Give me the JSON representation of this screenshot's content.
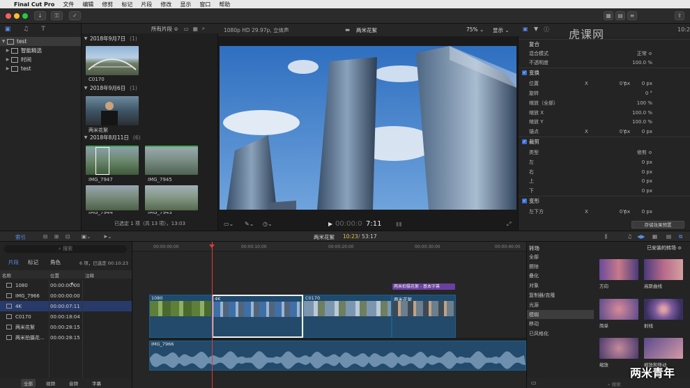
{
  "menubar": {
    "app": "Final Cut Pro",
    "items": [
      "文件",
      "编辑",
      "修剪",
      "标记",
      "片段",
      "修改",
      "显示",
      "窗口",
      "帮助"
    ]
  },
  "sidebar": {
    "items": [
      {
        "label": "test",
        "level": 0
      },
      {
        "label": "智能精选",
        "level": 1
      },
      {
        "label": "时间",
        "level": 1
      },
      {
        "label": "test",
        "level": 1
      }
    ]
  },
  "browser": {
    "filter": "所有片段 ≎",
    "groups": [
      {
        "date": "2018年9月7日",
        "count": "(1)"
      },
      {
        "date": "2018年9月6日",
        "count": "(1)"
      },
      {
        "date": "2018年8月11日",
        "count": "(6)"
      }
    ],
    "clips": [
      "C0170",
      "两米花絮",
      "IMG_7947",
      "IMG_7945",
      "IMG_7944",
      "IMG_7943"
    ],
    "status": "已选定 1 项（共 13 项），13:03"
  },
  "viewer": {
    "format": "1080p HD 29.97p, 立体声",
    "title": "两米花絮",
    "zoom": "75% ⌄",
    "display": "显示 ⌄",
    "timecode_dim": "00:00:0",
    "timecode": "7:11"
  },
  "inspector": {
    "rows": [
      {
        "label": "复合",
        "type": "header"
      },
      {
        "label": "混合模式",
        "v2": "正常 ≎"
      },
      {
        "label": "不透明度",
        "v2": "100.0 %"
      },
      {
        "label": "变换",
        "type": "section"
      },
      {
        "label": "位置",
        "c1": "X",
        "v1": "0 px",
        "c2": "Y",
        "v2": "0 px"
      },
      {
        "label": "旋转",
        "v2": "0 °"
      },
      {
        "label": "缩放（全部）",
        "v2": "100 %"
      },
      {
        "label": "缩放 X",
        "v2": "100.0 %"
      },
      {
        "label": "缩放 Y",
        "v2": "100.0 %"
      },
      {
        "label": "锚点",
        "c1": "X",
        "v1": "0 px",
        "c2": "Y",
        "v2": "0 px"
      },
      {
        "label": "裁剪",
        "type": "section"
      },
      {
        "label": "类型",
        "v2": "修剪 ≎"
      },
      {
        "label": "左",
        "v2": "0 px"
      },
      {
        "label": "右",
        "v2": "0 px"
      },
      {
        "label": "上",
        "v2": "0 px"
      },
      {
        "label": "下",
        "v2": "0 px"
      },
      {
        "label": "变形",
        "type": "section"
      },
      {
        "label": "左下方",
        "c1": "X",
        "v1": "0 px",
        "c2": "Y",
        "v2": "0 px"
      }
    ],
    "save_preset": "存储效果预置",
    "watermark": "虎课网"
  },
  "timeline_bar": {
    "index_label": "索引",
    "project": "两米花絮",
    "position": "10:23",
    "duration": "53:17",
    "transitions_title": "转场",
    "installed": "已安装的转场 ≎"
  },
  "index": {
    "tabs": [
      "片段",
      "标记",
      "角色"
    ],
    "summary": "6 项，已选定 00:10:23",
    "search_placeholder": "搜索",
    "columns": [
      "名称",
      "位置",
      "注释"
    ],
    "rows": [
      {
        "name": "1080",
        "pos": "00:00:00:00"
      },
      {
        "name": "IMG_7966",
        "pos": "00:00:00:00"
      },
      {
        "name": "4K",
        "pos": "00:00:07:11"
      },
      {
        "name": "C0170",
        "pos": "00:00:18:04"
      },
      {
        "name": "两米花絮",
        "pos": "00:00:28:15"
      },
      {
        "name": "两米拍摄花...",
        "pos": "00:00:28:15"
      }
    ],
    "bottom_tabs": [
      "全部",
      "视频",
      "音频",
      "字幕"
    ]
  },
  "timeline": {
    "ruler": [
      "00:00:00:00",
      "00:00:10:00",
      "00:00:20:00",
      "00:00:30:00",
      "00:00:40:00"
    ],
    "clips": [
      "1080",
      "4K",
      "C0170",
      "两米花絮"
    ],
    "title_clip": "两米拍摄花絮 - 基本字幕",
    "audio_clip": "IMG_7966"
  },
  "transitions": {
    "categories": [
      "全部",
      "擦除",
      "叠化",
      "对象",
      "复制器/克隆",
      "光源",
      "模糊",
      "移动",
      "已风格化"
    ],
    "selected": "模糊",
    "items": [
      "方向",
      "高斯曲线",
      "简单",
      "射线",
      "缩放",
      "缩放和移动"
    ],
    "search_placeholder": "搜索"
  },
  "overlay": {
    "brand": "两米青年"
  },
  "colors": {
    "accent": "#3b6fd8",
    "clip": "#1e4a6e",
    "title_clip": "#6b3fa0",
    "selected_row": "#283a6a",
    "playhead": "#e03c3c"
  }
}
